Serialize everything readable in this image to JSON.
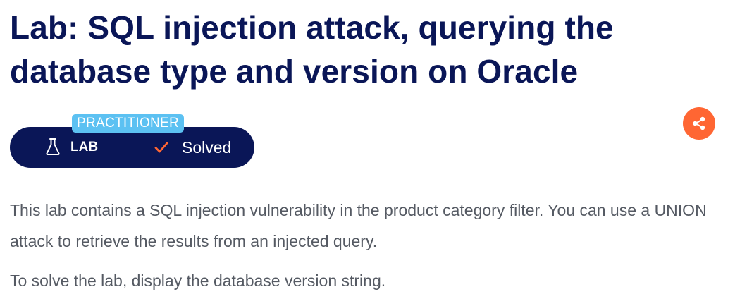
{
  "page": {
    "title": "Lab: SQL injection attack, querying the database type and version on Oracle"
  },
  "lab_badge": {
    "level": "PRACTITIONER",
    "type_label": "LAB",
    "type_icon": "flask-icon",
    "status_label": "Solved",
    "status_icon": "checkmark-icon"
  },
  "share": {
    "icon": "share-icon"
  },
  "description": {
    "paragraph_1": "This lab contains a SQL injection vulnerability in the product category filter. You can use a UNION attack to retrieve the results from an injected query.",
    "paragraph_2": "To solve the lab, display the database version string."
  },
  "colors": {
    "title": "#0a1657",
    "pill_background": "#0a1657",
    "level_badge": "#5cc1f2",
    "accent": "#ff6633",
    "body_text": "#555a63"
  }
}
